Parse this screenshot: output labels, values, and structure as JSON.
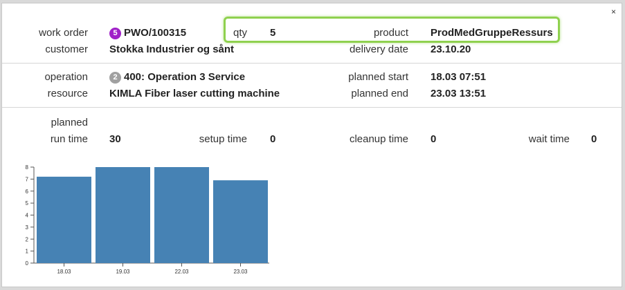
{
  "close_label": "×",
  "order": {
    "work_order_label": "work order",
    "work_order_badge": "5",
    "work_order_value": "PWO/100315",
    "customer_label": "customer",
    "customer_value": "Stokka Industrier og sånt",
    "qty_label": "qty",
    "qty_value": "5",
    "product_label": "product",
    "product_value": "ProdMedGruppeRessurs",
    "delivery_label": "delivery date",
    "delivery_value": "23.10.20"
  },
  "operation": {
    "operation_label": "operation",
    "operation_badge": "2",
    "operation_value": "400: Operation 3 Service",
    "resource_label": "resource",
    "resource_value": "KIMLA Fiber laser cutting machine",
    "planned_start_label": "planned start",
    "planned_start_value": "18.03 07:51",
    "planned_end_label": "planned end",
    "planned_end_value": "23.03 13:51"
  },
  "times": {
    "planned_label": "planned",
    "run_label": "run time",
    "run_value": "30",
    "setup_label": "setup time",
    "setup_value": "0",
    "cleanup_label": "cleanup time",
    "cleanup_value": "0",
    "wait_label": "wait time",
    "wait_value": "0"
  },
  "colors": {
    "order_badge": "#a020c8",
    "operation_badge": "#a0a0a0",
    "highlight": "#8fd14f",
    "bar": "#4682b4"
  },
  "chart_data": {
    "type": "bar",
    "categories": [
      "18.03",
      "19.03",
      "22.03",
      "23.03"
    ],
    "values": [
      7.2,
      8,
      8,
      6.9
    ],
    "ylim": [
      0,
      8
    ],
    "yticks": [
      0,
      1,
      2,
      3,
      4,
      5,
      6,
      7,
      8
    ],
    "grid": false
  }
}
